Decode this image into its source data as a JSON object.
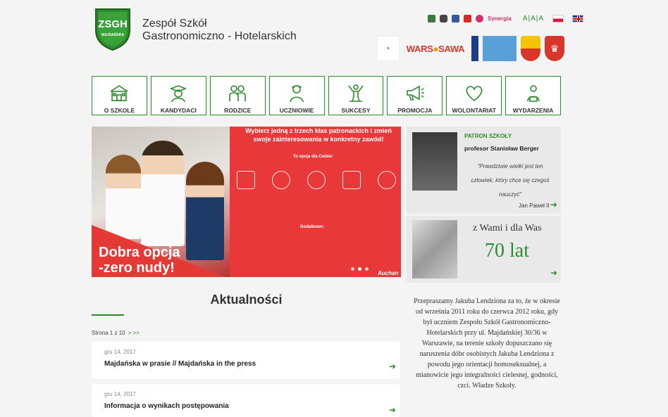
{
  "header": {
    "school_name_line1": "Zespół Szkół",
    "school_name_line2": "Gastronomiczno - Hotelarskich",
    "logo_text": "ZSGH",
    "logo_sub": "MAJDAŃSKA",
    "synergia": "Synergia",
    "font_size_label": "A|A|A"
  },
  "partners": {
    "wars_sawa_left": "WARS",
    "wars_sawa_right": "SAWA"
  },
  "nav": {
    "items": [
      {
        "label": "O SZKOLE",
        "icon": "school-building-icon"
      },
      {
        "label": "KANDYDACI",
        "icon": "graduate-icon"
      },
      {
        "label": "RODZICE",
        "icon": "parents-icon"
      },
      {
        "label": "UCZNIOWIE",
        "icon": "student-icon"
      },
      {
        "label": "SUKCESY",
        "icon": "success-icon"
      },
      {
        "label": "PROMOCJA",
        "icon": "megaphone-icon"
      },
      {
        "label": "WOLONTARIAT",
        "icon": "heart-icon"
      },
      {
        "label": "WYDARZENIA",
        "icon": "event-icon"
      }
    ]
  },
  "slider": {
    "title": "Wybierz jedną z trzech klas patronackich i zmień swoje zainteresowania w konkretny zawód!",
    "subtitle": "To opcja dla Ciebie!",
    "slogan_line1": "Dobra opcja",
    "slogan_line2": "-zero nudy!",
    "extra_label": "Dodatkowo:",
    "brand": "Auchan"
  },
  "patron": {
    "label": "PATRON SZKOŁY",
    "name": "profesor Stanisław Berger",
    "quote": "\"Prawdziwie wielki jest ten człowiek, który chce się czegoś nauczyć\"",
    "author": "Jan Paweł II"
  },
  "anniversary": {
    "text": "z Wami i dla Was",
    "years": "70 lat"
  },
  "news": {
    "title": "Aktualności",
    "pager_text": "Strona 1 z 10",
    "pager_next": "> >>",
    "items": [
      {
        "date": "gru 14, 2017",
        "headline": "Majdańska w prasie // Majdańska in the press"
      },
      {
        "date": "gru 14, 2017",
        "headline": "Informacja o wynikach postępowania"
      }
    ]
  },
  "apology": "Przepraszamy Jakuba Lendziona za to, że w okresie od września 2011 roku do czerwca 2012 roku, gdy był uczniem Zespołu Szkół Gastronomiczno-Hotelarskich przy ul. Majdańskiej 30/36 w Warszawie, na terenie szkoły dopuszczano się naruszenia dóbr osobistych Jakuba Lendziona z powodu jego orientacji homoseksualnej, a mianowicie jego integralności cielesnej, godności, czci. Władze Szkoły.",
  "colors": {
    "accent": "#2e8b2e",
    "slider_red": "#e53935",
    "panel_bg": "#e9e9e9"
  }
}
